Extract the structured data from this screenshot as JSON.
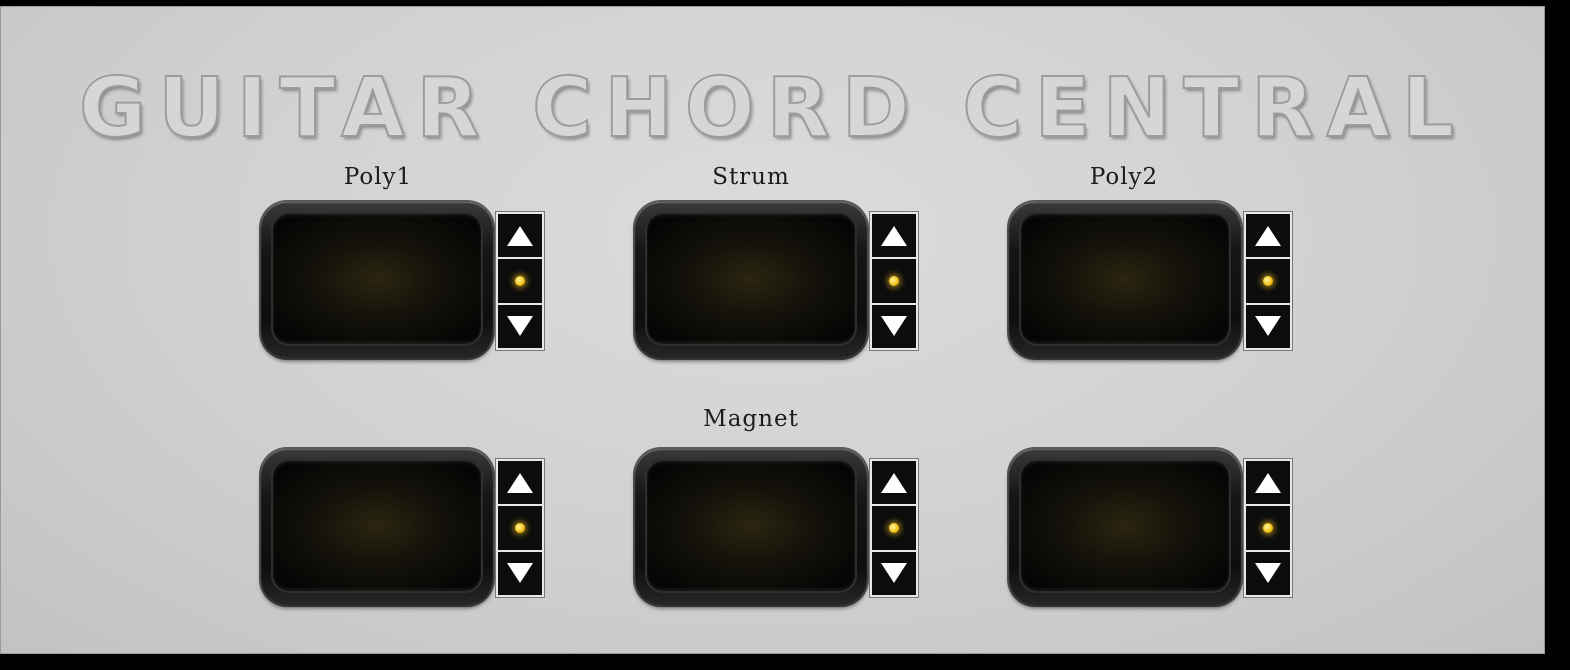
{
  "app": {
    "title": "GUITAR CHORD CENTRAL"
  },
  "accent_color": "#f2c21c",
  "icons": {
    "up": "triangle-up-icon",
    "down": "triangle-down-icon",
    "led": "led-indicator-icon"
  },
  "slots": [
    {
      "label": "Poly1",
      "display": ""
    },
    {
      "label": "Strum",
      "display": ""
    },
    {
      "label": "Poly2",
      "display": ""
    },
    {
      "label": "",
      "display": ""
    },
    {
      "label": "Magnet",
      "display": ""
    },
    {
      "label": "",
      "display": ""
    }
  ]
}
